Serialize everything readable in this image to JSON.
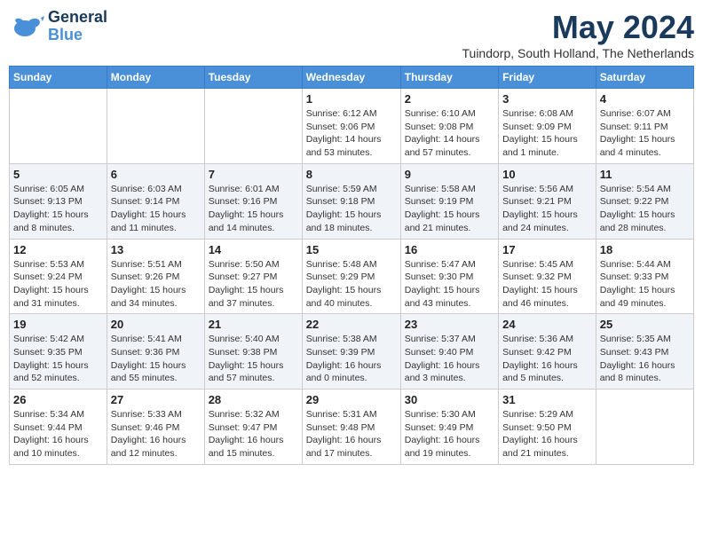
{
  "logo": {
    "line1": "General",
    "line2": "Blue"
  },
  "title": "May 2024",
  "location": "Tuindorp, South Holland, The Netherlands",
  "weekdays": [
    "Sunday",
    "Monday",
    "Tuesday",
    "Wednesday",
    "Thursday",
    "Friday",
    "Saturday"
  ],
  "weeks": [
    [
      {
        "day": "",
        "info": ""
      },
      {
        "day": "",
        "info": ""
      },
      {
        "day": "",
        "info": ""
      },
      {
        "day": "1",
        "info": "Sunrise: 6:12 AM\nSunset: 9:06 PM\nDaylight: 14 hours\nand 53 minutes."
      },
      {
        "day": "2",
        "info": "Sunrise: 6:10 AM\nSunset: 9:08 PM\nDaylight: 14 hours\nand 57 minutes."
      },
      {
        "day": "3",
        "info": "Sunrise: 6:08 AM\nSunset: 9:09 PM\nDaylight: 15 hours\nand 1 minute."
      },
      {
        "day": "4",
        "info": "Sunrise: 6:07 AM\nSunset: 9:11 PM\nDaylight: 15 hours\nand 4 minutes."
      }
    ],
    [
      {
        "day": "5",
        "info": "Sunrise: 6:05 AM\nSunset: 9:13 PM\nDaylight: 15 hours\nand 8 minutes."
      },
      {
        "day": "6",
        "info": "Sunrise: 6:03 AM\nSunset: 9:14 PM\nDaylight: 15 hours\nand 11 minutes."
      },
      {
        "day": "7",
        "info": "Sunrise: 6:01 AM\nSunset: 9:16 PM\nDaylight: 15 hours\nand 14 minutes."
      },
      {
        "day": "8",
        "info": "Sunrise: 5:59 AM\nSunset: 9:18 PM\nDaylight: 15 hours\nand 18 minutes."
      },
      {
        "day": "9",
        "info": "Sunrise: 5:58 AM\nSunset: 9:19 PM\nDaylight: 15 hours\nand 21 minutes."
      },
      {
        "day": "10",
        "info": "Sunrise: 5:56 AM\nSunset: 9:21 PM\nDaylight: 15 hours\nand 24 minutes."
      },
      {
        "day": "11",
        "info": "Sunrise: 5:54 AM\nSunset: 9:22 PM\nDaylight: 15 hours\nand 28 minutes."
      }
    ],
    [
      {
        "day": "12",
        "info": "Sunrise: 5:53 AM\nSunset: 9:24 PM\nDaylight: 15 hours\nand 31 minutes."
      },
      {
        "day": "13",
        "info": "Sunrise: 5:51 AM\nSunset: 9:26 PM\nDaylight: 15 hours\nand 34 minutes."
      },
      {
        "day": "14",
        "info": "Sunrise: 5:50 AM\nSunset: 9:27 PM\nDaylight: 15 hours\nand 37 minutes."
      },
      {
        "day": "15",
        "info": "Sunrise: 5:48 AM\nSunset: 9:29 PM\nDaylight: 15 hours\nand 40 minutes."
      },
      {
        "day": "16",
        "info": "Sunrise: 5:47 AM\nSunset: 9:30 PM\nDaylight: 15 hours\nand 43 minutes."
      },
      {
        "day": "17",
        "info": "Sunrise: 5:45 AM\nSunset: 9:32 PM\nDaylight: 15 hours\nand 46 minutes."
      },
      {
        "day": "18",
        "info": "Sunrise: 5:44 AM\nSunset: 9:33 PM\nDaylight: 15 hours\nand 49 minutes."
      }
    ],
    [
      {
        "day": "19",
        "info": "Sunrise: 5:42 AM\nSunset: 9:35 PM\nDaylight: 15 hours\nand 52 minutes."
      },
      {
        "day": "20",
        "info": "Sunrise: 5:41 AM\nSunset: 9:36 PM\nDaylight: 15 hours\nand 55 minutes."
      },
      {
        "day": "21",
        "info": "Sunrise: 5:40 AM\nSunset: 9:38 PM\nDaylight: 15 hours\nand 57 minutes."
      },
      {
        "day": "22",
        "info": "Sunrise: 5:38 AM\nSunset: 9:39 PM\nDaylight: 16 hours\nand 0 minutes."
      },
      {
        "day": "23",
        "info": "Sunrise: 5:37 AM\nSunset: 9:40 PM\nDaylight: 16 hours\nand 3 minutes."
      },
      {
        "day": "24",
        "info": "Sunrise: 5:36 AM\nSunset: 9:42 PM\nDaylight: 16 hours\nand 5 minutes."
      },
      {
        "day": "25",
        "info": "Sunrise: 5:35 AM\nSunset: 9:43 PM\nDaylight: 16 hours\nand 8 minutes."
      }
    ],
    [
      {
        "day": "26",
        "info": "Sunrise: 5:34 AM\nSunset: 9:44 PM\nDaylight: 16 hours\nand 10 minutes."
      },
      {
        "day": "27",
        "info": "Sunrise: 5:33 AM\nSunset: 9:46 PM\nDaylight: 16 hours\nand 12 minutes."
      },
      {
        "day": "28",
        "info": "Sunrise: 5:32 AM\nSunset: 9:47 PM\nDaylight: 16 hours\nand 15 minutes."
      },
      {
        "day": "29",
        "info": "Sunrise: 5:31 AM\nSunset: 9:48 PM\nDaylight: 16 hours\nand 17 minutes."
      },
      {
        "day": "30",
        "info": "Sunrise: 5:30 AM\nSunset: 9:49 PM\nDaylight: 16 hours\nand 19 minutes."
      },
      {
        "day": "31",
        "info": "Sunrise: 5:29 AM\nSunset: 9:50 PM\nDaylight: 16 hours\nand 21 minutes."
      },
      {
        "day": "",
        "info": ""
      }
    ]
  ]
}
